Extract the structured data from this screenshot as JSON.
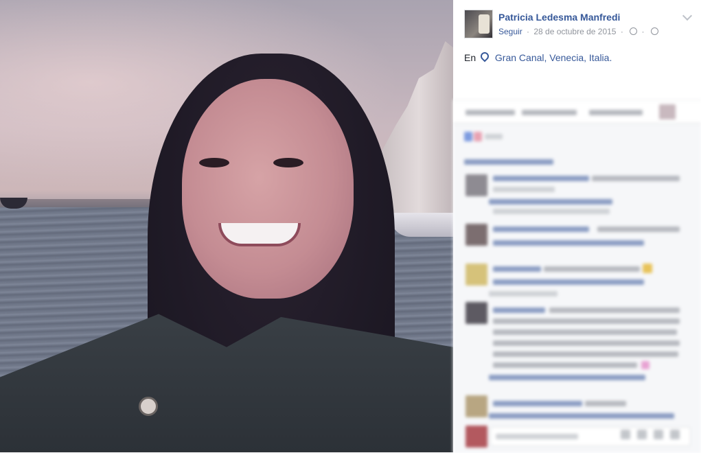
{
  "post": {
    "author": "Patricia Ledesma Manfredi",
    "follow_label": "Seguir",
    "separator": "·",
    "date": "28 de octubre de 2015",
    "location_prefix": "En",
    "location_name": "Gran Canal, Venecia, Italia."
  },
  "icons": {
    "location": "map-pin-icon",
    "audience": "globe-icon",
    "clock": "clock-icon",
    "menu": "chevron-down-icon"
  },
  "colors": {
    "link": "#365899",
    "meta": "#90949c",
    "panel_bg": "#ffffff",
    "comments_bg": "#f6f7f9"
  }
}
